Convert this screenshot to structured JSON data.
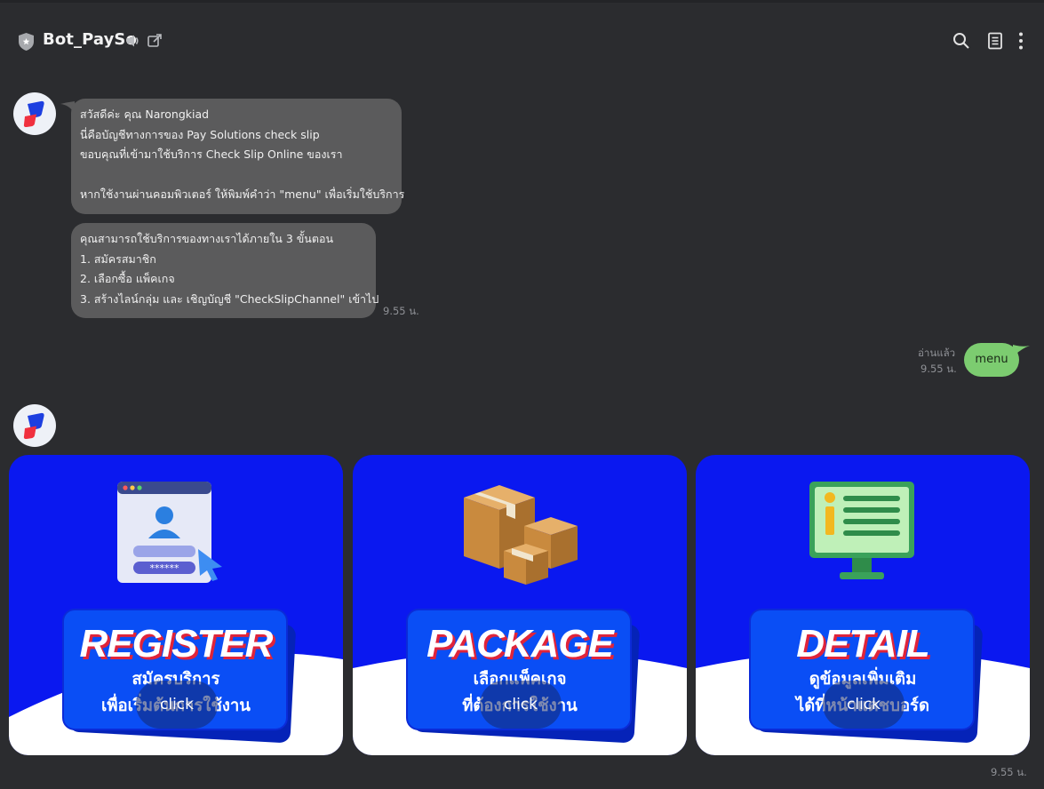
{
  "header": {
    "title": "Bot_PaySo",
    "icons": [
      "shield-icon",
      "speaker-icon",
      "external-link-icon",
      "search-icon",
      "notes-icon",
      "more-icon"
    ]
  },
  "messages": {
    "greeting_lines": [
      "สวัสดีค่ะ คุณ Narongkiad",
      "นี่คือบัญชีทางการของ Pay Solutions check slip",
      "ขอบคุณที่เข้ามาใช้บริการ Check Slip Online ของเรา",
      "",
      "หากใช้งานผ่านคอมพิวเตอร์ ให้พิมพ์คำว่า \"menu\" เพื่อเริ่มใช้บริการ"
    ],
    "steps_lines": [
      "คุณสามารถใช้บริการของทางเราได้ภายใน 3 ขั้นตอน",
      "1. สมัครสมาชิก",
      "2. เลือกซื้อ แพ็คเกจ",
      "3. สร้างไลน์กลุ่ม และ เชิญบัญชี \"CheckSlipChannel\" เข้าไป"
    ],
    "bot_time": "9.55 น.",
    "user_text": "menu",
    "read_label": "อ่านแล้ว",
    "user_time": "9.55 น.",
    "cards_time": "9.55 น."
  },
  "cards": [
    {
      "title": "REGISTER",
      "sub1": "สมัครบริการ",
      "sub2": "เพื่อเริ่มต้นการใช้งาน",
      "button": "click",
      "icon": "register-window-icon"
    },
    {
      "title": "PACKAGE",
      "sub1": "เลือกแพ็คเกจ",
      "sub2": "ที่ต้องการใช้งาน",
      "button": "click",
      "icon": "package-boxes-icon"
    },
    {
      "title": "DETAIL",
      "sub1": "ดูข้อมูลเพิ่มเติม",
      "sub2": "ได้ที่หน้าแดชบอร์ด",
      "button": "click",
      "icon": "info-monitor-icon"
    }
  ],
  "colors": {
    "background": "#2b2c2f",
    "bot_bubble": "#5b5b5c",
    "user_bubble": "#7ccc70",
    "card_blue": "#0a18f0",
    "accent_red": "#e0243a"
  }
}
